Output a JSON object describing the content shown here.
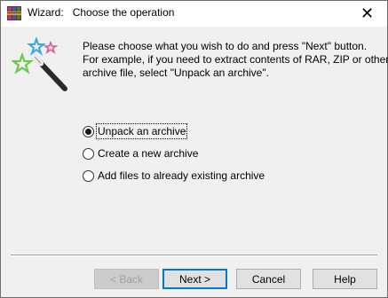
{
  "window": {
    "title_prefix": "Wizard:",
    "title": "Choose the operation",
    "app_icon": "winrar-icon",
    "close_glyph": "✕"
  },
  "instructions": {
    "line1": "Please choose what you wish to do and press \"Next\" button.",
    "line2": "For example, if you need to extract contents of RAR, ZIP or other",
    "line3": "archive file, select \"Unpack an archive\"."
  },
  "options": [
    {
      "label": "Unpack an archive",
      "selected": true
    },
    {
      "label": "Create a new archive",
      "selected": false
    },
    {
      "label": "Add files to already existing archive",
      "selected": false
    }
  ],
  "buttons": {
    "back": "< Back",
    "next": "Next >",
    "cancel": "Cancel",
    "help": "Help"
  },
  "colors": {
    "focus_border": "#0078d7",
    "background": "#f0f0f0"
  }
}
